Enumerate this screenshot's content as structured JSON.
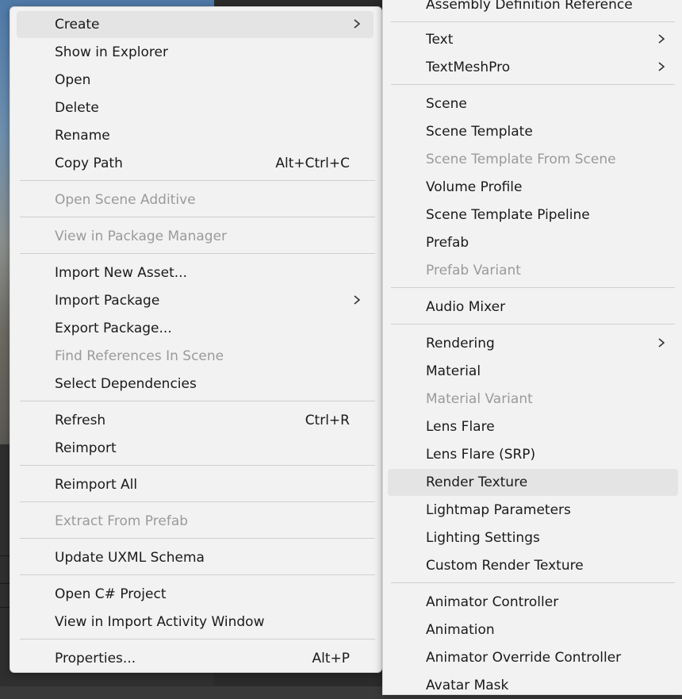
{
  "main_menu": {
    "items": [
      {
        "label": "Create"
      },
      {
        "label": "Show in Explorer"
      },
      {
        "label": "Open"
      },
      {
        "label": "Delete"
      },
      {
        "label": "Rename"
      },
      {
        "label": "Copy Path",
        "shortcut": "Alt+Ctrl+C"
      },
      {
        "label": "Open Scene Additive"
      },
      {
        "label": "View in Package Manager"
      },
      {
        "label": "Import New Asset..."
      },
      {
        "label": "Import Package"
      },
      {
        "label": "Export Package..."
      },
      {
        "label": "Find References In Scene"
      },
      {
        "label": "Select Dependencies"
      },
      {
        "label": "Refresh",
        "shortcut": "Ctrl+R"
      },
      {
        "label": "Reimport"
      },
      {
        "label": "Reimport All"
      },
      {
        "label": "Extract From Prefab"
      },
      {
        "label": "Update UXML Schema"
      },
      {
        "label": "Open C# Project"
      },
      {
        "label": "View in Import Activity Window"
      },
      {
        "label": "Properties...",
        "shortcut": "Alt+P"
      }
    ]
  },
  "sub_menu": {
    "items": [
      {
        "label": "Assembly Definition Reference"
      },
      {
        "label": "Text"
      },
      {
        "label": "TextMeshPro"
      },
      {
        "label": "Scene"
      },
      {
        "label": "Scene Template"
      },
      {
        "label": "Scene Template From Scene"
      },
      {
        "label": "Volume Profile"
      },
      {
        "label": "Scene Template Pipeline"
      },
      {
        "label": "Prefab"
      },
      {
        "label": "Prefab Variant"
      },
      {
        "label": "Audio Mixer"
      },
      {
        "label": "Rendering"
      },
      {
        "label": "Material"
      },
      {
        "label": "Material Variant"
      },
      {
        "label": "Lens Flare"
      },
      {
        "label": "Lens Flare (SRP)"
      },
      {
        "label": "Render Texture"
      },
      {
        "label": "Lightmap Parameters"
      },
      {
        "label": "Lighting Settings"
      },
      {
        "label": "Custom Render Texture"
      },
      {
        "label": "Animator Controller"
      },
      {
        "label": "Animation"
      },
      {
        "label": "Animator Override Controller"
      },
      {
        "label": "Avatar Mask"
      }
    ]
  },
  "colors": {
    "menu_bg": "#f2f2f2",
    "highlight": "#e4e4e4",
    "disabled_text": "#9a9a9a"
  },
  "icons": {
    "submenu_arrow": "chevron-right-icon"
  }
}
